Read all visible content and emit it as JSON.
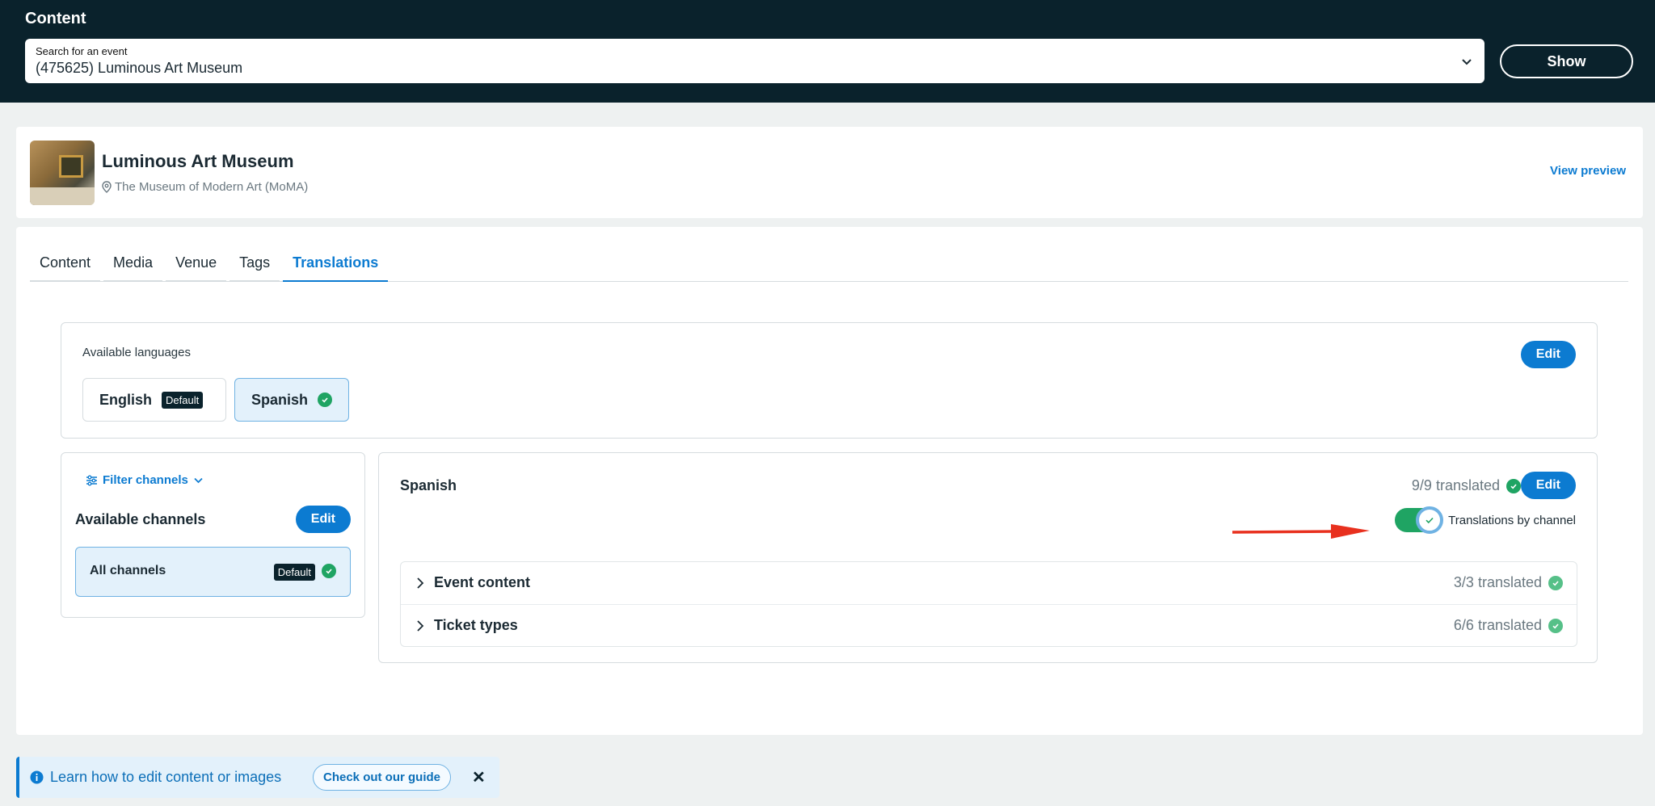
{
  "header": {
    "title": "Content",
    "search_label": "Search for an event",
    "search_value": "(475625) Luminous Art Museum",
    "show_label": "Show"
  },
  "event": {
    "name": "Luminous Art Museum",
    "venue": "The Museum of Modern Art (MoMA)",
    "view_preview": "View preview"
  },
  "tabs": [
    {
      "label": "Content"
    },
    {
      "label": "Media"
    },
    {
      "label": "Venue"
    },
    {
      "label": "Tags"
    },
    {
      "label": "Translations",
      "active": true
    }
  ],
  "languages": {
    "heading": "Available languages",
    "edit_label": "Edit",
    "items": [
      {
        "label": "English",
        "tag": "Default"
      },
      {
        "label": "Spanish"
      }
    ]
  },
  "channels": {
    "filter_label": "Filter channels",
    "heading": "Available channels",
    "edit_label": "Edit",
    "items": [
      {
        "label": "All channels",
        "tag": "Default"
      }
    ]
  },
  "spanish_panel": {
    "title": "Spanish",
    "translated": "9/9 translated",
    "edit_label": "Edit",
    "toggle_label": "Translations by channel",
    "toggle_on": true,
    "sections": [
      {
        "label": "Event content",
        "translated": "3/3 translated"
      },
      {
        "label": "Ticket types",
        "translated": "6/6 translated"
      }
    ]
  },
  "banner": {
    "text": "Learn how to edit content or images",
    "guide_label": "Check out our guide",
    "close_label": "✕"
  },
  "colors": {
    "header_bg": "#0a222c",
    "accent": "#0c7bd1",
    "success": "#1fa463",
    "annotation_arrow": "#e8301e"
  }
}
